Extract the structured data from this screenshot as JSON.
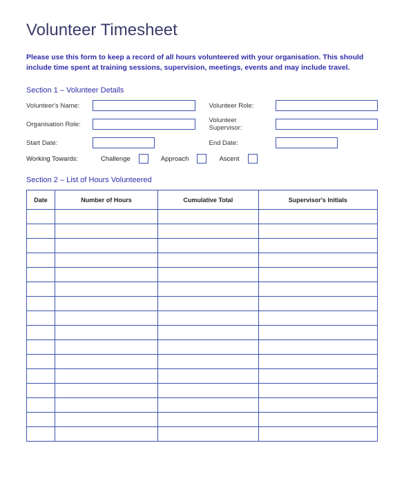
{
  "title": "Volunteer Timesheet",
  "intro": "Please use this form to keep a record of all hours volunteered with your organisation. This should include time spent at training sessions, supervision, meetings, events and may include travel.",
  "section1": {
    "title": "Section 1 – Volunteer Details",
    "labels": {
      "name": "Volunteer's Name:",
      "role": "Volunteer Role:",
      "orgRole": "Organisation Role:",
      "supervisor": "Volunteer Supervisor:",
      "startDate": "Start Date:",
      "endDate": "End Date:",
      "workingTowards": "Working Towards:",
      "challenge": "Challenge",
      "approach": "Approach",
      "ascent": "Ascent"
    }
  },
  "section2": {
    "title": "Section 2 – List of Hours Volunteered",
    "headers": [
      "Date",
      "Number of Hours",
      "Cumulative Total",
      "Supervisor's Initials"
    ],
    "rowCount": 16
  }
}
